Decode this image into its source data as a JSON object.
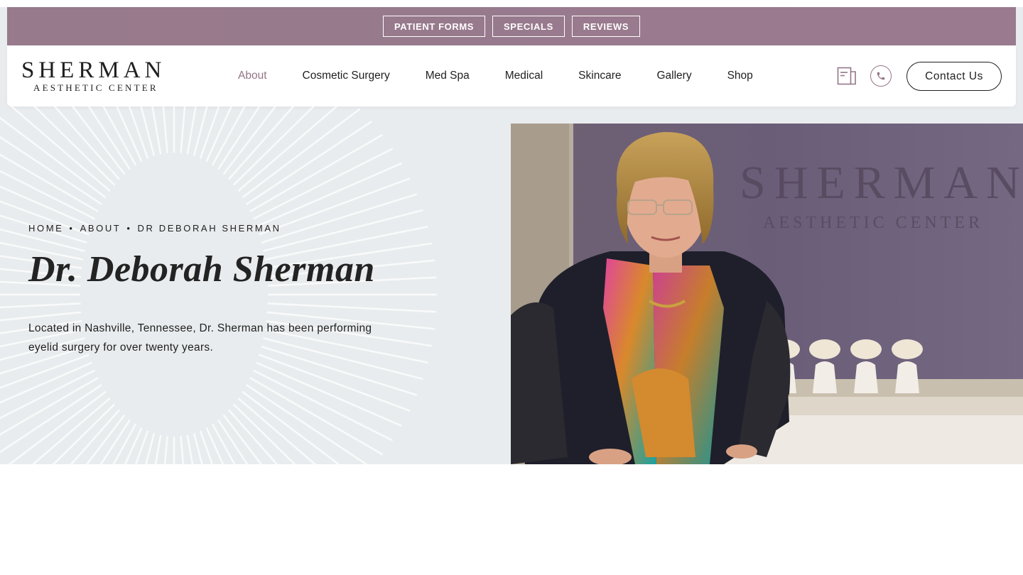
{
  "utility_bar": {
    "buttons": [
      "PATIENT FORMS",
      "SPECIALS",
      "REVIEWS"
    ]
  },
  "header": {
    "logo": {
      "main": "SHERMAN",
      "sub": "AESTHETIC CENTER"
    },
    "nav": [
      {
        "label": "About",
        "active": true
      },
      {
        "label": "Cosmetic Surgery",
        "active": false
      },
      {
        "label": "Med Spa",
        "active": false
      },
      {
        "label": "Medical",
        "active": false
      },
      {
        "label": "Skincare",
        "active": false
      },
      {
        "label": "Gallery",
        "active": false
      },
      {
        "label": "Shop",
        "active": false
      }
    ],
    "icons": [
      "document-icon",
      "phone-icon"
    ],
    "contact_label": "Contact Us"
  },
  "hero": {
    "breadcrumb": {
      "home": "HOME",
      "about": "ABOUT",
      "current": "DR DEBORAH SHERMAN",
      "separator": "•"
    },
    "title": "Dr. Deborah Sherman",
    "description": "Located in Nashville, Tennessee, Dr. Sherman has been performing eyelid surgery for over twenty years.",
    "photo_sign": {
      "main": "SHERMAN",
      "sub": "AESTHETIC CENTER"
    }
  },
  "colors": {
    "brand_mauve": "#977a8c",
    "hero_bg": "#e9ecee",
    "text": "#1f1f1f"
  }
}
